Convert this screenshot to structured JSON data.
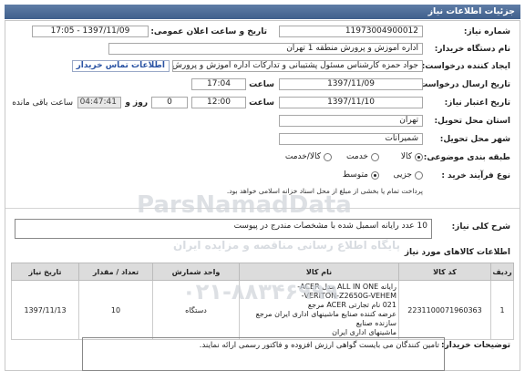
{
  "header": {
    "title": "جزئیات اطلاعات نیاز"
  },
  "form": {
    "need_number_label": "شماره نیاز:",
    "need_number": "11973004900012",
    "announce_label": "تاریخ و ساعت اعلان عمومی:",
    "announce_value": "1397/11/09 - 17:05",
    "buyer_org_label": "نام دستگاه خریدار:",
    "buyer_org": "اداره آموزش و پرورش منطقه 1 تهران",
    "creator_label": "ایجاد کننده درخواست:",
    "creator": "جواد حمزه کارشناس مسئول پشتیبانی و تدارکات اداره آموزش و پرورش منطقه 1",
    "contact_link": "اطلاعات تماس خریدار",
    "send_date_label": "تاریخ ارسال درخواست:",
    "send_date": "1397/11/09",
    "hour_label": "ساعت",
    "send_time": "17:04",
    "validity_label": "تاریخ اعتبار نیاز:",
    "validity_date": "1397/11/10",
    "validity_time": "12:00",
    "days": "0",
    "day_and_label": "روز و",
    "remaining_time": "04:47:41",
    "remaining_label": "ساعت باقی مانده",
    "province_label": "استان محل تحویل:",
    "province": "تهران",
    "city_label": "شهر محل تحویل:",
    "city": "شمیرانات",
    "category_label": "طبقه بندی موضوعی:",
    "category_options": [
      "کالا",
      "خدمت",
      "کالا/خدمت"
    ],
    "category_selected": "کالا",
    "purchase_label": "نوع فرآیند خرید :",
    "purchase_options": [
      "جزیی",
      "متوسط"
    ],
    "purchase_selected": "متوسط",
    "purchase_note": "پرداخت تمام یا بخشی از مبلغ از محل اسناد خزانه اسلامی خواهد بود."
  },
  "description": {
    "label": "شرح کلی نیاز:",
    "text": "10 عدد رایانه اسمبل شده با مشخصات مندرج در پیوست"
  },
  "goods": {
    "section_title": "اطلاعات کالاهای مورد نیاز",
    "columns": [
      "ردیف",
      "کد کالا",
      "نام کالا",
      "واحد شمارش",
      "تعداد / مقدار",
      "تاریخ نیاز"
    ],
    "rows": [
      {
        "row": "1",
        "code": "2231100071960363",
        "name_lines": [
          "رایانه ALL IN ONE مدل ACER-",
          "VERITON-Z2650G-VEHEM-",
          "021 نام تجارتی ACER مرجع",
          "عرضه کننده صنایع ماشینهای اداری ایران مرجع سازنده صنایع",
          "ماشینهای اداری ایران"
        ],
        "unit": "دستگاه",
        "qty": "10",
        "date": "1397/11/13"
      }
    ]
  },
  "buyer_notes": {
    "label": "توضیحات خریدار:",
    "text": "تامین کنندگان می بایست گواهی ارزش افزوده و فاکتور رسمی ارائه نمایند."
  },
  "watermark": {
    "brand": "ParsNamadData",
    "tagline": "پایگاه اطلاع رسانی مناقصه و مزایده ایران",
    "phone": "۰۲۱-۸۸۳۴۶۹۹۹"
  }
}
